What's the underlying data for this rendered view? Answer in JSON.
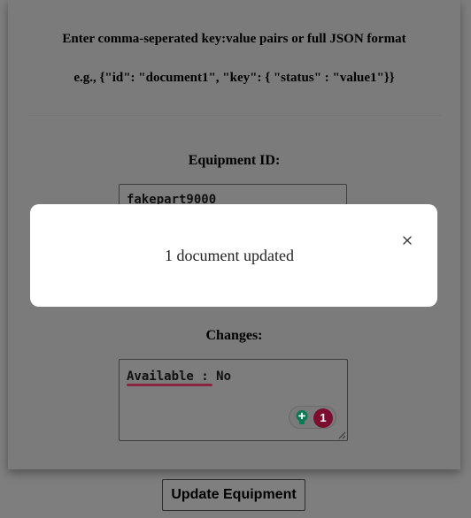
{
  "form": {
    "instruction_1": "Enter comma-seperated key:value pairs or full JSON format",
    "instruction_2": "e.g., {\"id\": \"document1\", \"key\": { \"status\" : \"value1\"}}",
    "equipment_id_label": "Equipment ID:",
    "equipment_id_value": "fakepart9000",
    "changes_label": "Changes:",
    "changes_value": "Available : No",
    "grammar_issue_count": "1",
    "update_button_label": "Update Equipment"
  },
  "modal": {
    "message": "1 document updated",
    "close_icon": "close-icon"
  },
  "colors": {
    "overlay": "#7e7e7e",
    "modal_bg": "#ffffff",
    "badge": "#7b0e2e",
    "bulb": "#0a7b55",
    "squiggle": "#8a2540"
  },
  "icons": {
    "grammar_bulb": "lightbulb-icon",
    "resize": "resize-handle-icon"
  }
}
